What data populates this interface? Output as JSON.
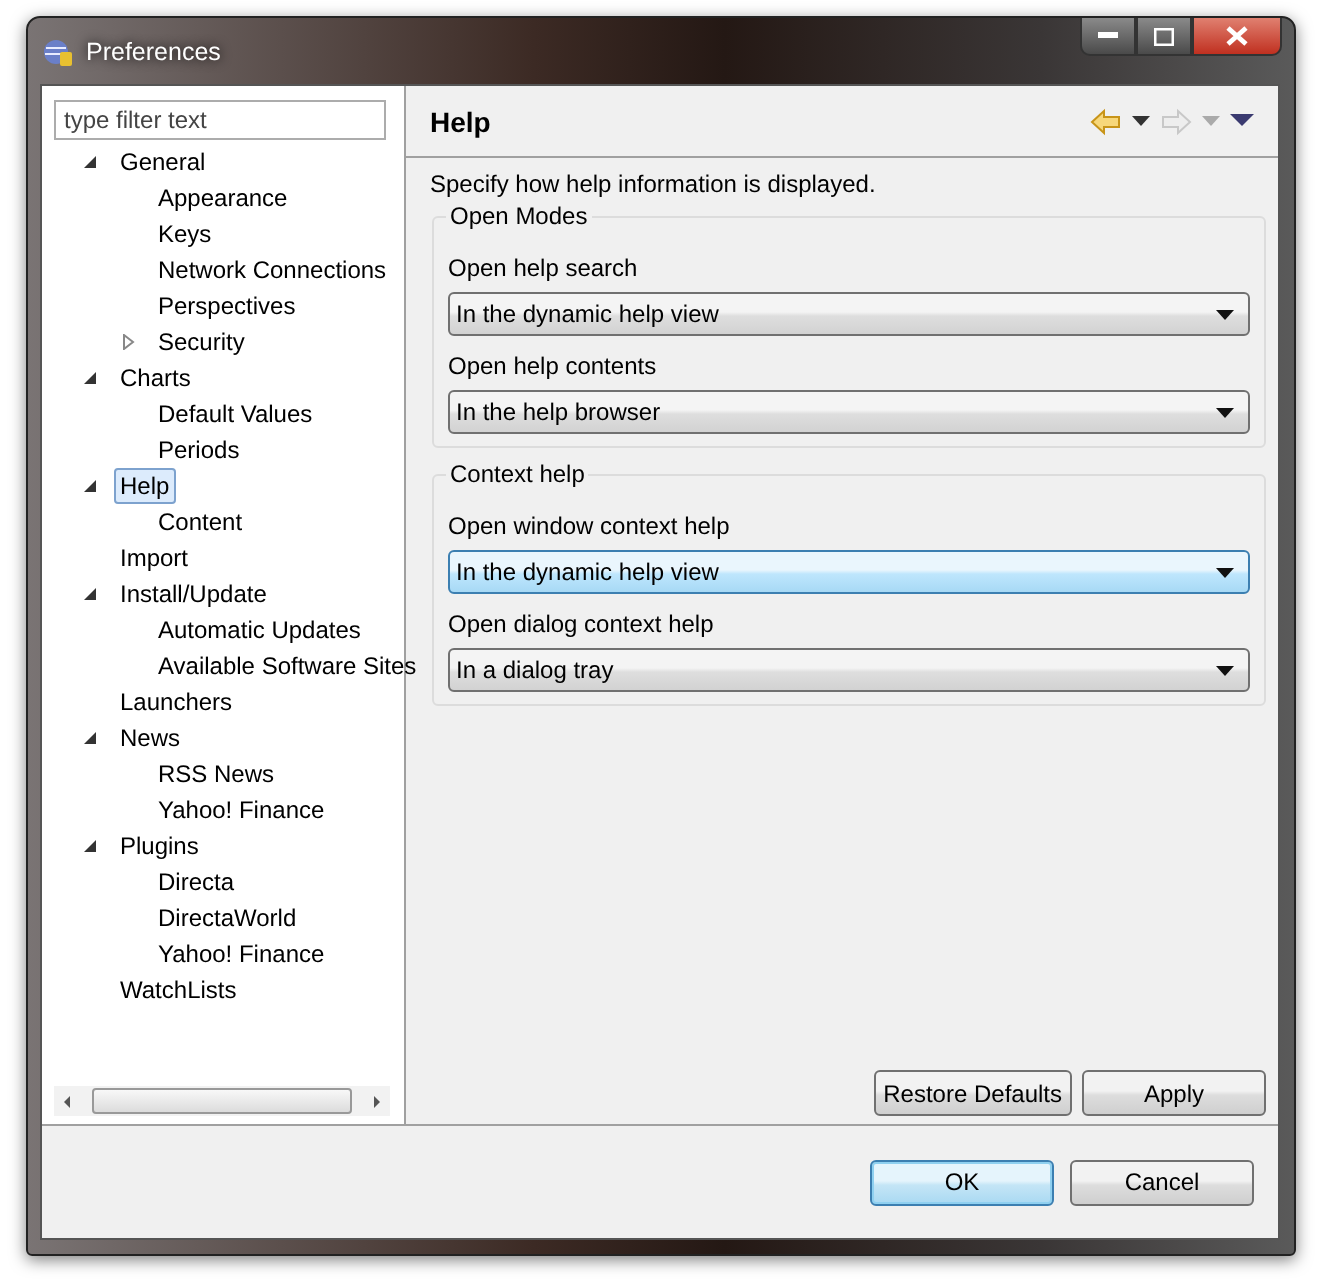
{
  "window": {
    "title": "Preferences"
  },
  "filter": {
    "placeholder": "type filter text"
  },
  "tree": [
    {
      "label": "General",
      "expanded": true,
      "selected": false,
      "children": [
        {
          "label": "Appearance",
          "selected": false
        },
        {
          "label": "Keys",
          "selected": false
        },
        {
          "label": "Network Connections",
          "selected": false
        },
        {
          "label": "Perspectives",
          "selected": false
        },
        {
          "label": "Security",
          "expanded": false,
          "selected": false
        }
      ]
    },
    {
      "label": "Charts",
      "expanded": true,
      "selected": false,
      "children": [
        {
          "label": "Default Values",
          "selected": false
        },
        {
          "label": "Periods",
          "selected": false
        }
      ]
    },
    {
      "label": "Help",
      "expanded": true,
      "selected": true,
      "children": [
        {
          "label": "Content",
          "selected": false
        }
      ]
    },
    {
      "label": "Import",
      "selected": false
    },
    {
      "label": "Install/Update",
      "expanded": true,
      "selected": false,
      "children": [
        {
          "label": "Automatic Updates",
          "selected": false
        },
        {
          "label": "Available Software Sites",
          "selected": false
        }
      ]
    },
    {
      "label": "Launchers",
      "selected": false
    },
    {
      "label": "News",
      "expanded": true,
      "selected": false,
      "children": [
        {
          "label": "RSS News",
          "selected": false
        },
        {
          "label": "Yahoo! Finance",
          "selected": false
        }
      ]
    },
    {
      "label": "Plugins",
      "expanded": true,
      "selected": false,
      "children": [
        {
          "label": "Directa",
          "selected": false
        },
        {
          "label": "DirectaWorld",
          "selected": false
        },
        {
          "label": "Yahoo! Finance",
          "selected": false
        }
      ]
    },
    {
      "label": "WatchLists",
      "selected": false
    }
  ],
  "page": {
    "title": "Help",
    "description": "Specify how help information is displayed.",
    "groups": [
      {
        "title": "Open Modes",
        "fields": [
          {
            "label": "Open help search",
            "value": "In the dynamic help view",
            "focused": false
          },
          {
            "label": "Open help contents",
            "value": "In the help browser",
            "focused": false
          }
        ]
      },
      {
        "title": "Context help",
        "fields": [
          {
            "label": "Open window context help",
            "value": "In the dynamic help view",
            "focused": true
          },
          {
            "label": "Open dialog context help",
            "value": "In a dialog tray",
            "focused": false
          }
        ]
      }
    ],
    "buttons": [
      {
        "label": "Restore Defaults",
        "default": false
      },
      {
        "label": "Apply",
        "default": false
      }
    ]
  },
  "buttons": [
    {
      "label": "OK",
      "default": true
    },
    {
      "label": "Cancel",
      "default": false
    }
  ]
}
